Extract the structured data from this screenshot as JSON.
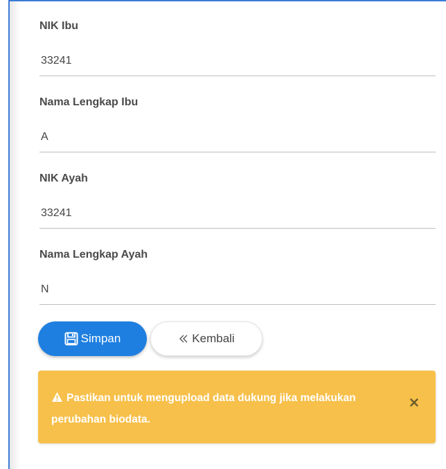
{
  "form": {
    "fields": [
      {
        "label": "NIK Ibu",
        "value": "33241"
      },
      {
        "label": "Nama Lengkap Ibu",
        "value": "A"
      },
      {
        "label": "NIK Ayah",
        "value": "33241"
      },
      {
        "label": "Nama Lengkap Ayah",
        "value": "N"
      }
    ]
  },
  "actions": {
    "save_label": "Simpan",
    "back_label": "Kembali"
  },
  "alert": {
    "message": "Pastikan untuk mengupload data dukung jika melakukan perubahan biodata."
  },
  "icons": {
    "save": "floppy-disk-icon",
    "back": "double-chevron-left-icon",
    "warning": "warning-triangle-icon",
    "close": "close-icon"
  },
  "colors": {
    "primary": "#1e7fe0",
    "warning_bg": "#f7c04a",
    "frame_border": "#3a7bd5"
  }
}
